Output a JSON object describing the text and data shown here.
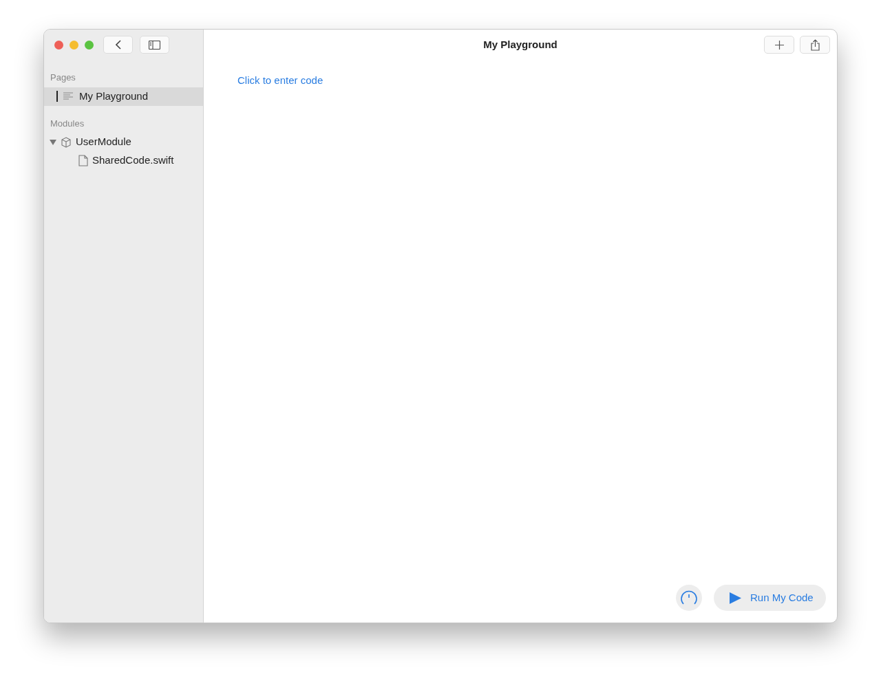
{
  "window": {
    "title": "My Playground"
  },
  "sidebar": {
    "sections": [
      {
        "kind": "pages",
        "heading": "Pages",
        "items": [
          {
            "label": "My Playground",
            "selected": true
          }
        ]
      },
      {
        "kind": "modules",
        "heading": "Modules",
        "items": [
          {
            "label": "UserModule",
            "selected": false,
            "expanded": true,
            "children": [
              {
                "label": "SharedCode.swift",
                "selected": false
              }
            ]
          }
        ]
      }
    ]
  },
  "editor": {
    "prompt": "Click to enter code"
  },
  "run_button": {
    "label": "Run My Code"
  }
}
